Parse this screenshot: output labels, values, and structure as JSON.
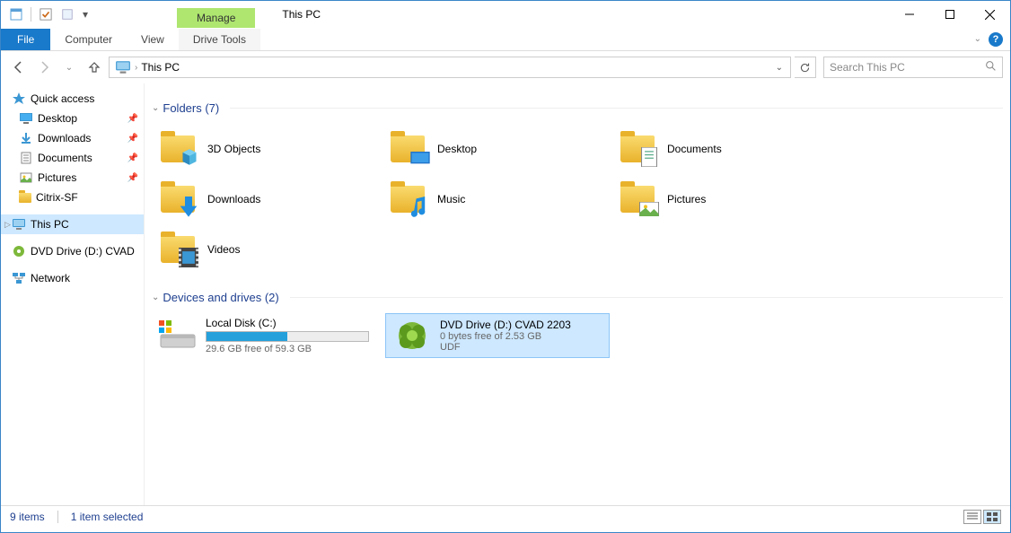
{
  "window": {
    "title": "This PC",
    "context_tab": "Manage",
    "ribbon": {
      "file": "File",
      "tabs": [
        "Computer",
        "View"
      ],
      "context_subtab": "Drive Tools"
    }
  },
  "nav": {
    "path": "This PC",
    "search_placeholder": "Search This PC"
  },
  "sidebar": {
    "quick_access": "Quick access",
    "items": [
      {
        "label": "Desktop",
        "pinned": true
      },
      {
        "label": "Downloads",
        "pinned": true
      },
      {
        "label": "Documents",
        "pinned": true
      },
      {
        "label": "Pictures",
        "pinned": true
      },
      {
        "label": "Citrix-SF",
        "pinned": false
      }
    ],
    "this_pc": "This PC",
    "dvd": "DVD Drive (D:) CVAD",
    "network": "Network"
  },
  "groups": {
    "folders": {
      "title": "Folders (7)",
      "items": [
        "3D Objects",
        "Desktop",
        "Documents",
        "Downloads",
        "Music",
        "Pictures",
        "Videos"
      ]
    },
    "drives": {
      "title": "Devices and drives (2)",
      "local": {
        "name": "Local Disk (C:)",
        "free": "29.6 GB free of 59.3 GB",
        "fill_pct": 50
      },
      "dvd": {
        "name": "DVD Drive (D:) CVAD 2203",
        "free": "0 bytes free of 2.53 GB",
        "fs": "UDF"
      }
    }
  },
  "status": {
    "count": "9 items",
    "selected": "1 item selected"
  }
}
